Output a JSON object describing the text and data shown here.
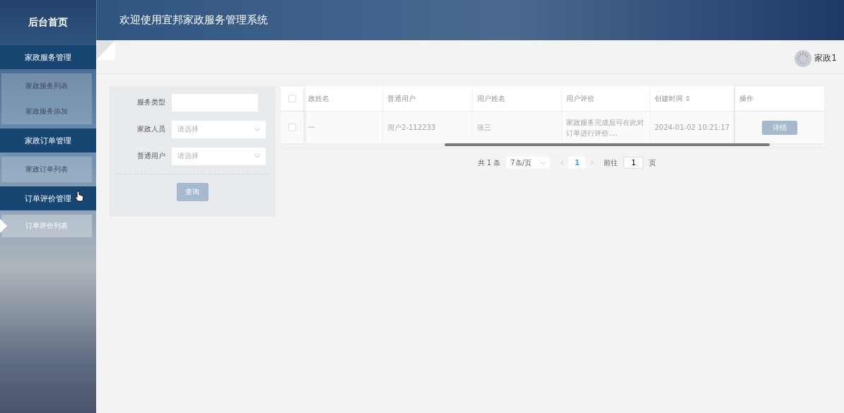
{
  "sidebar": {
    "title": "后台首页",
    "groups": [
      {
        "label": "家政服务管理",
        "items": [
          {
            "label": "家政服务列表",
            "selected": false
          },
          {
            "label": "家政服务添加",
            "selected": false
          }
        ]
      },
      {
        "label": "家政订单管理",
        "items": [
          {
            "label": "家政订单列表",
            "selected": false
          }
        ]
      },
      {
        "label": "订单评价管理",
        "items": [
          {
            "label": "订单评价列表",
            "selected": true
          }
        ]
      }
    ]
  },
  "header": {
    "title": "欢迎使用宜邦家政服务管理系统"
  },
  "user": {
    "name": "家政1"
  },
  "search_form": {
    "fields": [
      {
        "label": "服务类型",
        "kind": "input"
      },
      {
        "label": "家政人员",
        "kind": "select",
        "placeholder": "请选择"
      },
      {
        "label": "普通用户",
        "kind": "select",
        "placeholder": "请选择"
      }
    ],
    "button": "查询"
  },
  "table": {
    "all_checked": false,
    "columns": [
      {
        "label": "政姓名",
        "sortable": false
      },
      {
        "label": "普通用户",
        "sortable": false
      },
      {
        "label": "用户姓名",
        "sortable": false
      },
      {
        "label": "用户评价",
        "sortable": false
      },
      {
        "label": "创建时间",
        "sortable": true
      },
      {
        "label": "操作",
        "sortable": false
      }
    ],
    "rows": [
      {
        "checked": false,
        "cells": [
          "一",
          "用户2-112233",
          "张三",
          "家政服务完成后可在此对订单进行评价....",
          "2024-01-02 10:21:17"
        ],
        "action": "详情"
      }
    ]
  },
  "pagination": {
    "total": "共 1 条",
    "page_size": "7条/页",
    "pages": [
      {
        "label": "1",
        "selected": true
      }
    ],
    "goto_label": "前往",
    "goto_value": "1",
    "goto_suffix": "页"
  }
}
